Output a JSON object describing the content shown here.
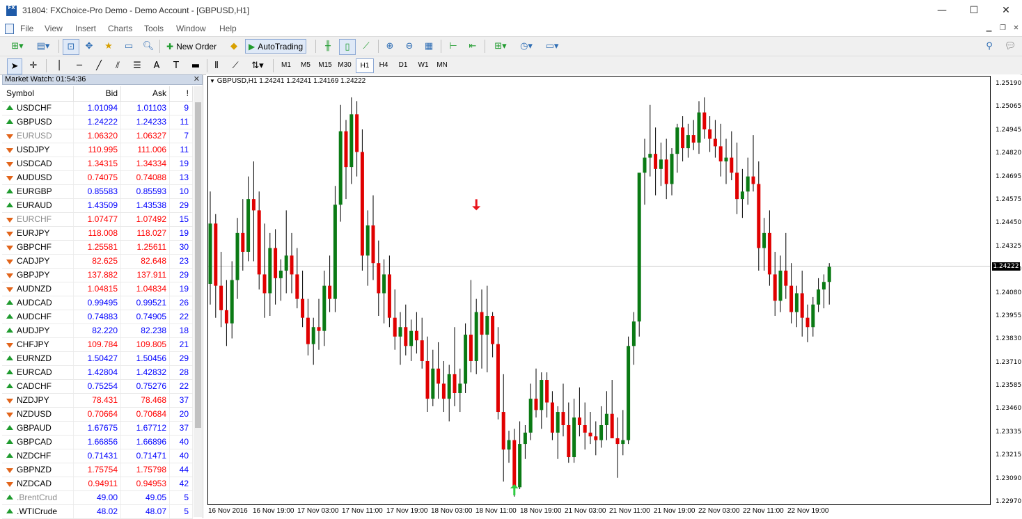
{
  "window": {
    "title": "31804: FXChoice-Pro Demo - Demo Account - [GBPUSD,H1]",
    "app_icon_text": "FX",
    "minimize": "—",
    "maximize": "☐",
    "close": "✕"
  },
  "menu": [
    "File",
    "View",
    "Insert",
    "Charts",
    "Tools",
    "Window",
    "Help"
  ],
  "toolbar": {
    "new_order": "New Order",
    "auto_trading": "AutoTrading",
    "timeframes": [
      "M1",
      "M5",
      "M15",
      "M30",
      "H1",
      "H4",
      "D1",
      "W1",
      "MN"
    ],
    "active_timeframe": "H1"
  },
  "market_watch": {
    "title": "Market Watch: 01:54:36",
    "columns": [
      "Symbol",
      "Bid",
      "Ask",
      "!"
    ],
    "rows": [
      {
        "symbol": "USDCHF",
        "bid": "1.01094",
        "ask": "1.01103",
        "spread": "9",
        "dir": "up",
        "color": "#0000ff"
      },
      {
        "symbol": "GBPUSD",
        "bid": "1.24222",
        "ask": "1.24233",
        "spread": "11",
        "dir": "up",
        "color": "#0000ff"
      },
      {
        "symbol": "EURUSD",
        "bid": "1.06320",
        "ask": "1.06327",
        "spread": "7",
        "dir": "down",
        "color": "#ff0000",
        "grey": true
      },
      {
        "symbol": "USDJPY",
        "bid": "110.995",
        "ask": "111.006",
        "spread": "11",
        "dir": "down",
        "color": "#ff0000"
      },
      {
        "symbol": "USDCAD",
        "bid": "1.34315",
        "ask": "1.34334",
        "spread": "19",
        "dir": "down",
        "color": "#ff0000"
      },
      {
        "symbol": "AUDUSD",
        "bid": "0.74075",
        "ask": "0.74088",
        "spread": "13",
        "dir": "down",
        "color": "#ff0000"
      },
      {
        "symbol": "EURGBP",
        "bid": "0.85583",
        "ask": "0.85593",
        "spread": "10",
        "dir": "up",
        "color": "#0000ff"
      },
      {
        "symbol": "EURAUD",
        "bid": "1.43509",
        "ask": "1.43538",
        "spread": "29",
        "dir": "up",
        "color": "#0000ff"
      },
      {
        "symbol": "EURCHF",
        "bid": "1.07477",
        "ask": "1.07492",
        "spread": "15",
        "dir": "down",
        "color": "#ff0000",
        "grey": true
      },
      {
        "symbol": "EURJPY",
        "bid": "118.008",
        "ask": "118.027",
        "spread": "19",
        "dir": "down",
        "color": "#ff0000"
      },
      {
        "symbol": "GBPCHF",
        "bid": "1.25581",
        "ask": "1.25611",
        "spread": "30",
        "dir": "down",
        "color": "#ff0000"
      },
      {
        "symbol": "CADJPY",
        "bid": "82.625",
        "ask": "82.648",
        "spread": "23",
        "dir": "down",
        "color": "#ff0000"
      },
      {
        "symbol": "GBPJPY",
        "bid": "137.882",
        "ask": "137.911",
        "spread": "29",
        "dir": "down",
        "color": "#ff0000"
      },
      {
        "symbol": "AUDNZD",
        "bid": "1.04815",
        "ask": "1.04834",
        "spread": "19",
        "dir": "down",
        "color": "#ff0000"
      },
      {
        "symbol": "AUDCAD",
        "bid": "0.99495",
        "ask": "0.99521",
        "spread": "26",
        "dir": "up",
        "color": "#0000ff"
      },
      {
        "symbol": "AUDCHF",
        "bid": "0.74883",
        "ask": "0.74905",
        "spread": "22",
        "dir": "up",
        "color": "#0000ff"
      },
      {
        "symbol": "AUDJPY",
        "bid": "82.220",
        "ask": "82.238",
        "spread": "18",
        "dir": "up",
        "color": "#0000ff"
      },
      {
        "symbol": "CHFJPY",
        "bid": "109.784",
        "ask": "109.805",
        "spread": "21",
        "dir": "down",
        "color": "#ff0000"
      },
      {
        "symbol": "EURNZD",
        "bid": "1.50427",
        "ask": "1.50456",
        "spread": "29",
        "dir": "up",
        "color": "#0000ff"
      },
      {
        "symbol": "EURCAD",
        "bid": "1.42804",
        "ask": "1.42832",
        "spread": "28",
        "dir": "up",
        "color": "#0000ff"
      },
      {
        "symbol": "CADCHF",
        "bid": "0.75254",
        "ask": "0.75276",
        "spread": "22",
        "dir": "up",
        "color": "#0000ff"
      },
      {
        "symbol": "NZDJPY",
        "bid": "78.431",
        "ask": "78.468",
        "spread": "37",
        "dir": "down",
        "color": "#ff0000"
      },
      {
        "symbol": "NZDUSD",
        "bid": "0.70664",
        "ask": "0.70684",
        "spread": "20",
        "dir": "down",
        "color": "#ff0000"
      },
      {
        "symbol": "GBPAUD",
        "bid": "1.67675",
        "ask": "1.67712",
        "spread": "37",
        "dir": "up",
        "color": "#0000ff"
      },
      {
        "symbol": "GBPCAD",
        "bid": "1.66856",
        "ask": "1.66896",
        "spread": "40",
        "dir": "up",
        "color": "#0000ff"
      },
      {
        "symbol": "NZDCHF",
        "bid": "0.71431",
        "ask": "0.71471",
        "spread": "40",
        "dir": "up",
        "color": "#0000ff"
      },
      {
        "symbol": "GBPNZD",
        "bid": "1.75754",
        "ask": "1.75798",
        "spread": "44",
        "dir": "down",
        "color": "#ff0000"
      },
      {
        "symbol": "NZDCAD",
        "bid": "0.94911",
        "ask": "0.94953",
        "spread": "42",
        "dir": "down",
        "color": "#ff0000"
      },
      {
        "symbol": ".BrentCrud",
        "bid": "49.00",
        "ask": "49.05",
        "spread": "5",
        "dir": "up",
        "color": "#0000ff",
        "grey": true
      },
      {
        "symbol": ".WTICrude",
        "bid": "48.02",
        "ask": "48.07",
        "spread": "5",
        "dir": "up",
        "color": "#0000ff"
      }
    ]
  },
  "chart": {
    "label": "GBPUSD,H1  1.24241 1.24241 1.24169 1.24222",
    "current_price": "1.24222",
    "price_labels": [
      "1.25190",
      "1.25065",
      "1.24945",
      "1.24820",
      "1.24695",
      "1.24575",
      "1.24450",
      "1.24325",
      "1.24200",
      "1.24080",
      "1.23955",
      "1.23830",
      "1.23710",
      "1.23585",
      "1.23460",
      "1.23335",
      "1.23215",
      "1.23090",
      "1.22970"
    ],
    "time_labels": [
      "16 Nov 2016",
      "16 Nov 19:00",
      "17 Nov 03:00",
      "17 Nov 11:00",
      "17 Nov 19:00",
      "18 Nov 03:00",
      "18 Nov 11:00",
      "18 Nov 19:00",
      "21 Nov 03:00",
      "21 Nov 11:00",
      "21 Nov 19:00",
      "22 Nov 03:00",
      "22 Nov 11:00",
      "22 Nov 19:00"
    ],
    "bull_color": "#0a7a14",
    "bear_color": "#e00000",
    "marker_down_color": "#e8141c",
    "marker_up_color": "#2ecc40"
  },
  "chart_data": {
    "type": "candlestick",
    "symbol": "GBPUSD",
    "timeframe": "H1",
    "ylim": [
      1.2297,
      1.2519
    ],
    "candles": [
      [
        1.2413,
        1.2462,
        1.2402,
        1.2445
      ],
      [
        1.2445,
        1.245,
        1.2395,
        1.2412
      ],
      [
        1.2412,
        1.243,
        1.239,
        1.2399
      ],
      [
        1.2399,
        1.2415,
        1.238,
        1.2392
      ],
      [
        1.2392,
        1.2425,
        1.2384,
        1.2415
      ],
      [
        1.2415,
        1.2448,
        1.2405,
        1.244
      ],
      [
        1.244,
        1.2458,
        1.242,
        1.243
      ],
      [
        1.243,
        1.247,
        1.2425,
        1.2458
      ],
      [
        1.2458,
        1.2478,
        1.2425,
        1.2452
      ],
      [
        1.2452,
        1.2462,
        1.241,
        1.2418
      ],
      [
        1.2418,
        1.2445,
        1.2395,
        1.2408
      ],
      [
        1.2408,
        1.244,
        1.2396,
        1.2432
      ],
      [
        1.2432,
        1.2442,
        1.2402,
        1.2416
      ],
      [
        1.2416,
        1.2426,
        1.2404,
        1.242
      ],
      [
        1.242,
        1.2452,
        1.2408,
        1.2428
      ],
      [
        1.2428,
        1.244,
        1.2408,
        1.2418
      ],
      [
        1.2418,
        1.2432,
        1.24,
        1.2405
      ],
      [
        1.2405,
        1.242,
        1.239,
        1.2395
      ],
      [
        1.2395,
        1.2405,
        1.2375,
        1.2381
      ],
      [
        1.2381,
        1.2395,
        1.237,
        1.239
      ],
      [
        1.239,
        1.2405,
        1.2378,
        1.2388
      ],
      [
        1.2388,
        1.242,
        1.238,
        1.2412
      ],
      [
        1.2412,
        1.2428,
        1.2398,
        1.2405
      ],
      [
        1.2405,
        1.2465,
        1.2398,
        1.2455
      ],
      [
        1.2455,
        1.2508,
        1.2446,
        1.2494
      ],
      [
        1.2494,
        1.25,
        1.2458,
        1.2475
      ],
      [
        1.2475,
        1.2512,
        1.2466,
        1.2503
      ],
      [
        1.2503,
        1.251,
        1.247,
        1.2483
      ],
      [
        1.2483,
        1.2495,
        1.242,
        1.2428
      ],
      [
        1.2428,
        1.2452,
        1.2412,
        1.2444
      ],
      [
        1.2444,
        1.246,
        1.2415,
        1.2424
      ],
      [
        1.2424,
        1.2436,
        1.2396,
        1.2408
      ],
      [
        1.2408,
        1.2426,
        1.2392,
        1.2418
      ],
      [
        1.2418,
        1.2428,
        1.239,
        1.2395
      ],
      [
        1.2395,
        1.241,
        1.2378,
        1.2385
      ],
      [
        1.2385,
        1.2398,
        1.237,
        1.239
      ],
      [
        1.239,
        1.2402,
        1.2375,
        1.238
      ],
      [
        1.238,
        1.2394,
        1.2372,
        1.2388
      ],
      [
        1.2388,
        1.2398,
        1.2376,
        1.2383
      ],
      [
        1.2383,
        1.2395,
        1.2368,
        1.2372
      ],
      [
        1.2372,
        1.2385,
        1.2345,
        1.2352
      ],
      [
        1.2352,
        1.2378,
        1.2348,
        1.2368
      ],
      [
        1.2368,
        1.2382,
        1.2352,
        1.236
      ],
      [
        1.236,
        1.2372,
        1.2345,
        1.2352
      ],
      [
        1.2352,
        1.237,
        1.234,
        1.2365
      ],
      [
        1.2365,
        1.239,
        1.2348,
        1.2355
      ],
      [
        1.2355,
        1.2368,
        1.2345,
        1.236
      ],
      [
        1.236,
        1.2392,
        1.2355,
        1.2386
      ],
      [
        1.2386,
        1.2415,
        1.2366,
        1.2372
      ],
      [
        1.2372,
        1.2405,
        1.2365,
        1.2398
      ],
      [
        1.2398,
        1.241,
        1.2368,
        1.2386
      ],
      [
        1.2386,
        1.2412,
        1.2366,
        1.2396
      ],
      [
        1.2396,
        1.2398,
        1.2374,
        1.2381
      ],
      [
        1.2381,
        1.239,
        1.2341,
        1.2345
      ],
      [
        1.2345,
        1.2365,
        1.2308,
        1.2325
      ],
      [
        1.2325,
        1.2335,
        1.2318,
        1.233
      ],
      [
        1.233,
        1.2336,
        1.23,
        1.2305
      ],
      [
        1.2305,
        1.234,
        1.2304,
        1.2328
      ],
      [
        1.2328,
        1.2338,
        1.232,
        1.2334
      ],
      [
        1.2334,
        1.236,
        1.233,
        1.2352
      ],
      [
        1.2352,
        1.2368,
        1.2342,
        1.2346
      ],
      [
        1.2346,
        1.2366,
        1.2336,
        1.2362
      ],
      [
        1.2362,
        1.2366,
        1.2342,
        1.235
      ],
      [
        1.235,
        1.2356,
        1.233,
        1.2334
      ],
      [
        1.2334,
        1.2348,
        1.232,
        1.2345
      ],
      [
        1.2345,
        1.236,
        1.2332,
        1.2338
      ],
      [
        1.2338,
        1.235,
        1.2318,
        1.2321
      ],
      [
        1.2321,
        1.2352,
        1.2318,
        1.2342
      ],
      [
        1.2342,
        1.2358,
        1.2332,
        1.2338
      ],
      [
        1.2338,
        1.235,
        1.2325,
        1.2334
      ],
      [
        1.2334,
        1.2345,
        1.2328,
        1.2332
      ],
      [
        1.2332,
        1.234,
        1.2322,
        1.233
      ],
      [
        1.233,
        1.2348,
        1.2326,
        1.2338
      ],
      [
        1.2338,
        1.2356,
        1.233,
        1.2344
      ],
      [
        1.2344,
        1.2362,
        1.2336,
        1.2331
      ],
      [
        1.2331,
        1.2342,
        1.231,
        1.2328
      ],
      [
        1.2328,
        1.2346,
        1.2322,
        1.233
      ],
      [
        1.233,
        1.2385,
        1.2328,
        1.238
      ],
      [
        1.238,
        1.2398,
        1.237,
        1.2393
      ],
      [
        1.2393,
        1.2412,
        1.2385,
        1.2472
      ],
      [
        1.2472,
        1.249,
        1.2455,
        1.248
      ],
      [
        1.248,
        1.2508,
        1.247,
        1.2482
      ],
      [
        1.2482,
        1.2496,
        1.246,
        1.2474
      ],
      [
        1.2474,
        1.2488,
        1.2465,
        1.2479
      ],
      [
        1.2479,
        1.249,
        1.2458,
        1.2466
      ],
      [
        1.2466,
        1.2485,
        1.246,
        1.2482
      ],
      [
        1.2482,
        1.2498,
        1.2472,
        1.2496
      ],
      [
        1.2496,
        1.2502,
        1.2478,
        1.2485
      ],
      [
        1.2485,
        1.2498,
        1.248,
        1.2492
      ],
      [
        1.2492,
        1.25,
        1.2484,
        1.2488
      ],
      [
        1.2488,
        1.251,
        1.2482,
        1.2504
      ],
      [
        1.2504,
        1.2512,
        1.249,
        1.2495
      ],
      [
        1.2495,
        1.2502,
        1.2483,
        1.249
      ],
      [
        1.249,
        1.25,
        1.248,
        1.2486
      ],
      [
        1.2486,
        1.2498,
        1.247,
        1.2478
      ],
      [
        1.2478,
        1.249,
        1.2466,
        1.248
      ],
      [
        1.248,
        1.2494,
        1.2468,
        1.2472
      ],
      [
        1.2472,
        1.2488,
        1.245,
        1.2458
      ],
      [
        1.2458,
        1.2474,
        1.2448,
        1.2462
      ],
      [
        1.2462,
        1.248,
        1.2455,
        1.247
      ],
      [
        1.247,
        1.2492,
        1.2462,
        1.2466
      ],
      [
        1.2466,
        1.2478,
        1.242,
        1.2432
      ],
      [
        1.2432,
        1.2448,
        1.242,
        1.244
      ],
      [
        1.244,
        1.2452,
        1.2412,
        1.2418
      ],
      [
        1.2418,
        1.243,
        1.2396,
        1.2404
      ],
      [
        1.2404,
        1.2428,
        1.2398,
        1.242
      ],
      [
        1.242,
        1.244,
        1.2405,
        1.2412
      ],
      [
        1.2412,
        1.2424,
        1.2392,
        1.2398
      ],
      [
        1.2398,
        1.2412,
        1.239,
        1.2408
      ],
      [
        1.2408,
        1.242,
        1.2385,
        1.2395
      ],
      [
        1.2395,
        1.2402,
        1.2382,
        1.239
      ],
      [
        1.239,
        1.2406,
        1.2385,
        1.2402
      ],
      [
        1.2402,
        1.2416,
        1.2398,
        1.241
      ],
      [
        1.241,
        1.2418,
        1.24,
        1.2414
      ],
      [
        1.2414,
        1.2424,
        1.2402,
        1.2422
      ]
    ],
    "current_price": 1.24222,
    "markers": [
      {
        "type": "down-arrow",
        "color": "red"
      },
      {
        "type": "up-arrow",
        "color": "green"
      }
    ]
  }
}
